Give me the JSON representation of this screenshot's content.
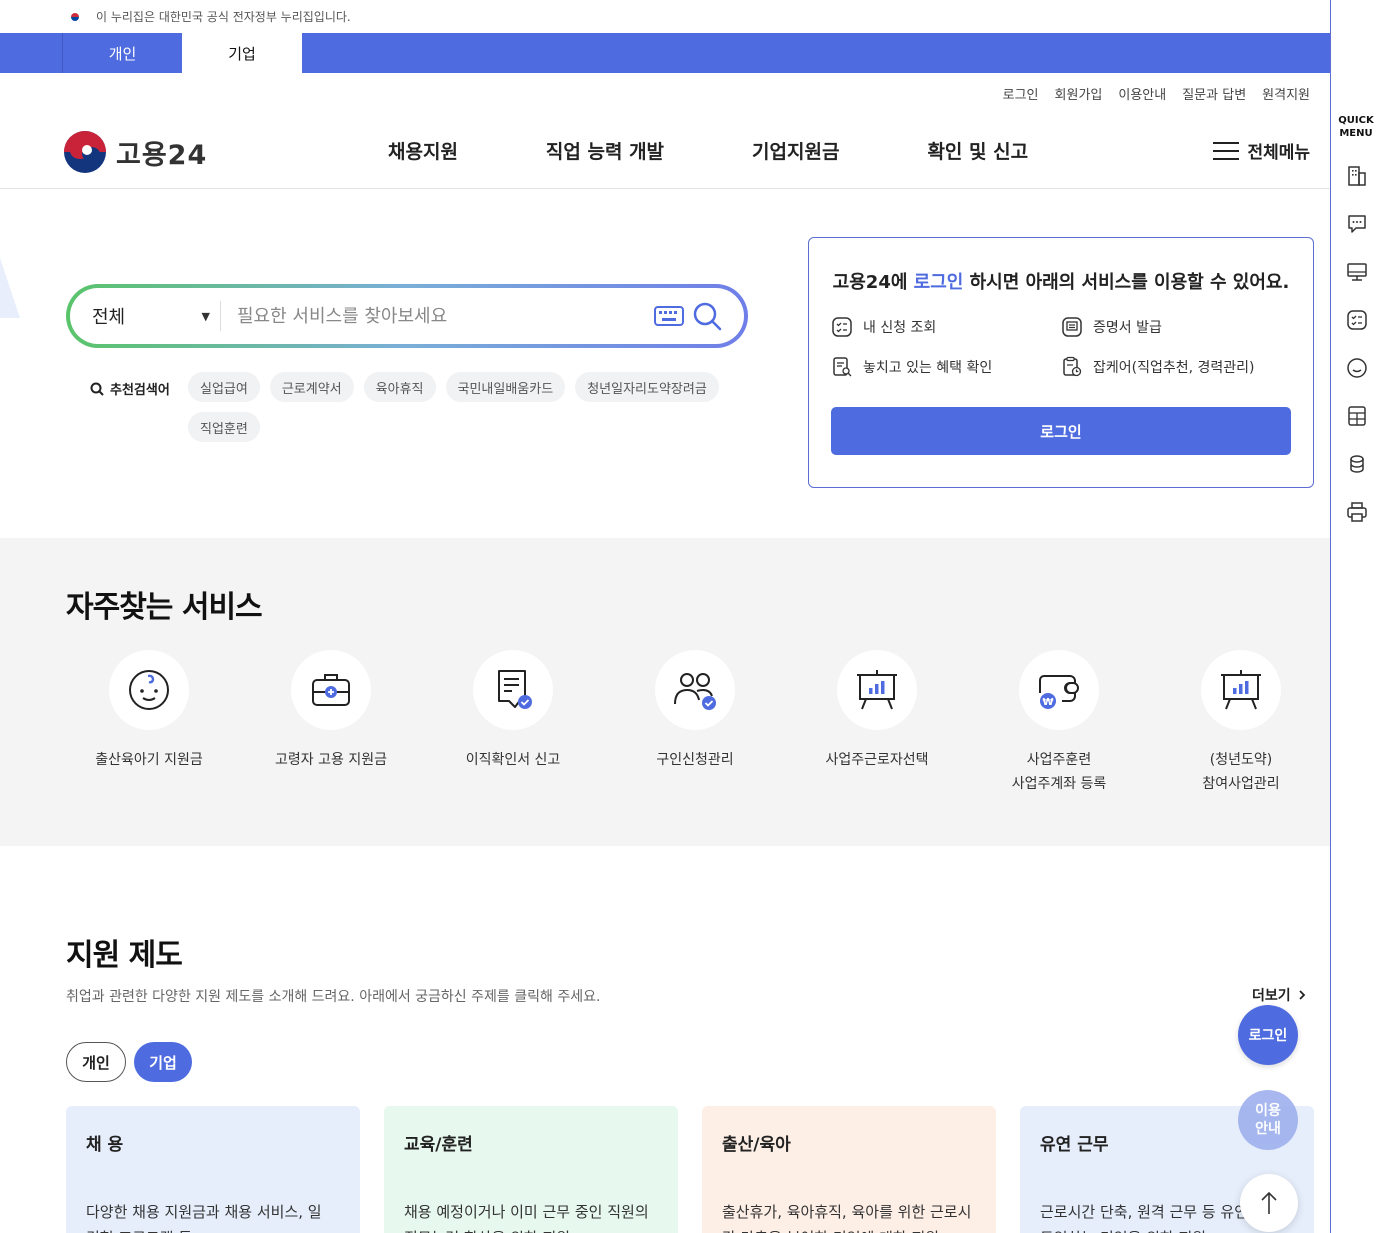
{
  "gov_banner": {
    "text": "이 누리집은 대한민국 공식 전자정부 누리집입니다."
  },
  "top_tabs": {
    "personal": "개인",
    "company": "기업"
  },
  "util_links": [
    "로그인",
    "회원가입",
    "이용안내",
    "질문과 답변",
    "원격지원"
  ],
  "logo": {
    "text": "고용24"
  },
  "gnb": [
    "채용지원",
    "직업 능력 개발",
    "기업지원금",
    "확인 및 신고"
  ],
  "all_menu": "전체메뉴",
  "search": {
    "scope": "전체",
    "placeholder": "필요한 서비스를 찾아보세요",
    "reco_label": "추천검색어",
    "chips": [
      "실업급여",
      "근로계약서",
      "육아휴직",
      "국민내일배움카드",
      "청년일자리도약장려금",
      "직업훈련"
    ]
  },
  "login_card": {
    "title_pre": "고용24에 ",
    "title_hl": "로그인",
    "title_post": " 하시면 아래의 서비스를 이용할 수 있어요.",
    "services": [
      "내 신청 조회",
      "증명서 발급",
      "놓치고 있는 혜택 확인",
      "잡케어(직업추천, 경력관리)"
    ],
    "button": "로그인"
  },
  "frequent": {
    "title": "자주찾는 서비스",
    "items": [
      {
        "label": "출산육아기 지원금",
        "icon": "baby-face-icon"
      },
      {
        "label": "고령자 고용 지원금",
        "icon": "medical-bag-icon"
      },
      {
        "label": "이직확인서 신고",
        "icon": "document-check-icon"
      },
      {
        "label": "구인신청관리",
        "icon": "people-check-icon"
      },
      {
        "label": "사업주근로자선택",
        "icon": "presentation-chart-icon"
      },
      {
        "label": "사업주훈련\n사업주계좌 등록",
        "icon": "wallet-won-icon"
      },
      {
        "label": "(청년도약)\n참여사업관리",
        "icon": "presentation-chart-icon"
      }
    ]
  },
  "support": {
    "title": "지원 제도",
    "desc": "취업과 관련한 다양한 지원 제도를 소개해 드려요. 아래에서 궁금하신 주제를 클릭해 주세요.",
    "more": "더보기",
    "toggle": [
      "개인",
      "기업"
    ],
    "cards": [
      {
        "title": "채 용",
        "text": "다양한 채용 지원금과 채용 서비스, 일 경험 프로그램 등"
      },
      {
        "title": "교육/훈련",
        "text": "채용 예정이거나 이미 근무 중인 직원의 직무능력 향상을 위한 지원"
      },
      {
        "title": "출산/육아",
        "text": "출산휴가, 육아휴직, 육아를 위한 근로시간 단축을 부여한 기업에 대한 지원"
      },
      {
        "title": "유연 근무",
        "text": "근로시간 단축, 원격 근무 등 유연근무를 도입하는 기업을 위한 지원"
      }
    ]
  },
  "floating": {
    "login": "로그인",
    "guide": "이용\n안내"
  },
  "quick_menu": {
    "title": "QUICK\nMENU"
  },
  "colors": {
    "primary": "#4f6be0",
    "freq_bg": "#f4f4f4"
  }
}
